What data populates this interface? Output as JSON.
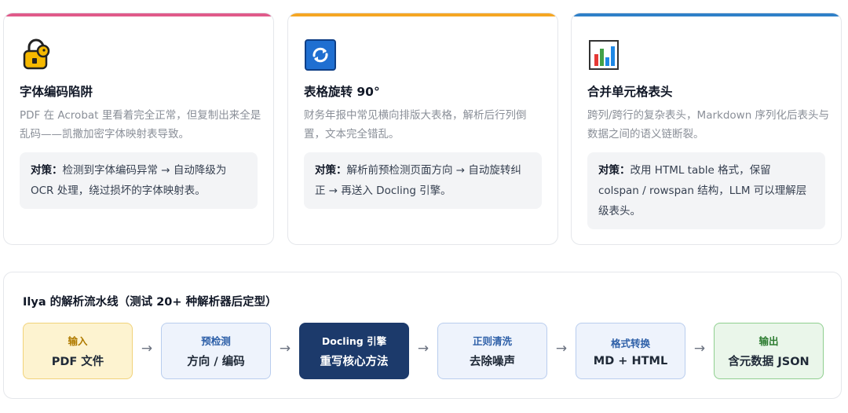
{
  "cards": [
    {
      "icon": "lock-icon",
      "accent": "#e05a8a",
      "title": "字体编码陷阱",
      "desc": "PDF 在 Acrobat 里看着完全正常，但复制出来全是乱码——凯撒加密字体映射表导致。",
      "label": "对策：",
      "text": "检测到字体编码异常 → 自动降级为 OCR 处理，绕过损坏的字体映射表。"
    },
    {
      "icon": "rotate-icon",
      "accent": "#f5a623",
      "title": "表格旋转 90°",
      "desc": "财务年报中常见横向排版大表格，解析后行列倒置，文本完全错乱。",
      "label": "对策：",
      "text": "解析前预检测页面方向 → 自动旋转纠正 → 再送入 Docling 引擎。"
    },
    {
      "icon": "bar-chart-icon",
      "accent": "#2f80c8",
      "title": "合并单元格表头",
      "desc": "跨列/跨行的复杂表头，Markdown 序列化后表头与数据之间的语义链断裂。",
      "label": "对策：",
      "text": "改用 HTML table 格式，保留 colspan / rowspan 结构，LLM 可以理解层级表头。"
    }
  ],
  "pipeline": {
    "title": "Ilya 的解析流水线（测试 20+ 种解析器后定型）",
    "arrow": "→",
    "steps": [
      {
        "top": "输入",
        "main": "PDF 文件",
        "bg": "#fdf3d0",
        "border": "#f1d27a",
        "topColor": "#b07b00",
        "mainColor": "#1f2937"
      },
      {
        "top": "预检测",
        "main": "方向 / 编码",
        "bg": "#eef3fc",
        "border": "#b9cdee",
        "topColor": "#2d5fa8",
        "mainColor": "#1f2937"
      },
      {
        "top": "Docling 引擎",
        "main": "重写核心方法",
        "bg": "#1c3a6b",
        "border": "#1c3a6b",
        "topColor": "#ffffff",
        "mainColor": "#ffffff"
      },
      {
        "top": "正则清洗",
        "main": "去除噪声",
        "bg": "#eef3fc",
        "border": "#b9cdee",
        "topColor": "#2d5fa8",
        "mainColor": "#1f2937"
      },
      {
        "top": "格式转换",
        "main": "MD + HTML",
        "bg": "#eef3fc",
        "border": "#b9cdee",
        "topColor": "#2d5fa8",
        "mainColor": "#1f2937"
      },
      {
        "top": "输出",
        "main": "含元数据 JSON",
        "bg": "#eaf6ea",
        "border": "#8fcf8f",
        "topColor": "#2e7d32",
        "mainColor": "#1f2937"
      }
    ]
  }
}
